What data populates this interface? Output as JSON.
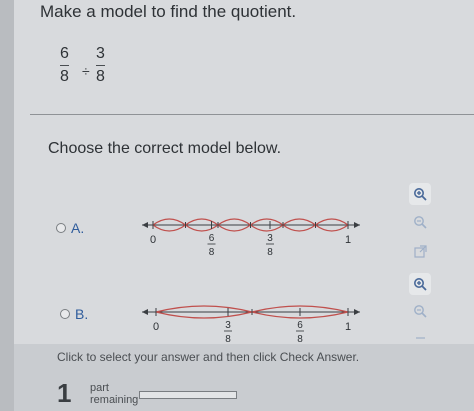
{
  "question": {
    "title": "Make a model to find the quotient.",
    "dividend": {
      "numerator": "6",
      "denominator": "8"
    },
    "operator": "÷",
    "divisor": {
      "numerator": "3",
      "denominator": "8"
    }
  },
  "prompt": "Choose the correct model below.",
  "options": [
    {
      "letter": "A.",
      "ticks": [
        {
          "value": 0,
          "label": "0"
        },
        {
          "value": 0.75,
          "label_num": "6",
          "label_den": "8"
        },
        {
          "value": 1.5,
          "label_num": "3",
          "label_den": "8"
        },
        {
          "value": 2.5,
          "label": "1"
        }
      ],
      "segments": 6
    },
    {
      "letter": "B.",
      "ticks": [
        {
          "value": 0,
          "label": "0"
        },
        {
          "value": 0.375,
          "label_num": "3",
          "label_den": "8"
        },
        {
          "value": 0.75,
          "label_num": "6",
          "label_den": "8"
        },
        {
          "value": 1,
          "label": "1"
        }
      ],
      "segments": 2
    }
  ],
  "tools": [
    "zoom-in-icon",
    "zoom-out-icon",
    "popout-icon"
  ],
  "footer": {
    "hint": "Click to select your answer and then click Check Answer.",
    "parts_count": "1",
    "parts_label_line1": "part",
    "parts_label_line2": "remaining",
    "progress_fraction": 0.0
  },
  "colors": {
    "arc": "#c0504d",
    "link": "#2f5c9c"
  }
}
